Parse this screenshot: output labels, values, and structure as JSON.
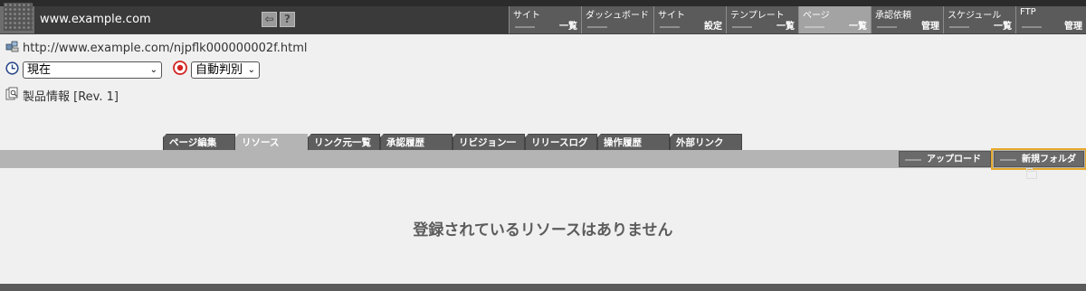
{
  "header": {
    "site_url": "www.example.com",
    "tool_buttons": [
      {
        "icon": "back-arrow-icon",
        "glyph": "⇦"
      },
      {
        "icon": "help-icon",
        "glyph": "?"
      }
    ],
    "menus": [
      {
        "top": "サイト",
        "sub": "一覧",
        "active": false
      },
      {
        "top": "ダッシュボード",
        "sub": "",
        "active": false
      },
      {
        "top": "サイト",
        "sub": "設定",
        "active": false
      },
      {
        "top": "テンプレート",
        "sub": "一覧",
        "active": false
      },
      {
        "top": "ページ",
        "sub": "一覧",
        "active": true
      },
      {
        "top": "承認依頼",
        "sub": "管理",
        "active": false
      },
      {
        "top": "スケジュール",
        "sub": "一覧",
        "active": false
      },
      {
        "top": "FTP",
        "sub": "管理",
        "active": false
      }
    ]
  },
  "info": {
    "page_url": "http://www.example.com/njpflk000000002f.html",
    "time_select": "現在",
    "mode_select": "自動判別",
    "page_title": "製品情報 [Rev. 1]"
  },
  "tabs": [
    "ページ編集",
    "リソース",
    "リンク元一覧",
    "承認履歴",
    "リビジョン一覧",
    "リリースログ",
    "操作履歴",
    "外部リンク"
  ],
  "active_tab": "リソース",
  "actions": {
    "upload": "アップロード",
    "new_folder": "新規フォルダ"
  },
  "empty_message": "登録されているリソースはありません",
  "colors": {
    "topbar": "#6e6e6e",
    "menu_active": "#a3a3a3",
    "focus_outline": "#e6a92a",
    "tabbar": "#b4b4b4"
  }
}
